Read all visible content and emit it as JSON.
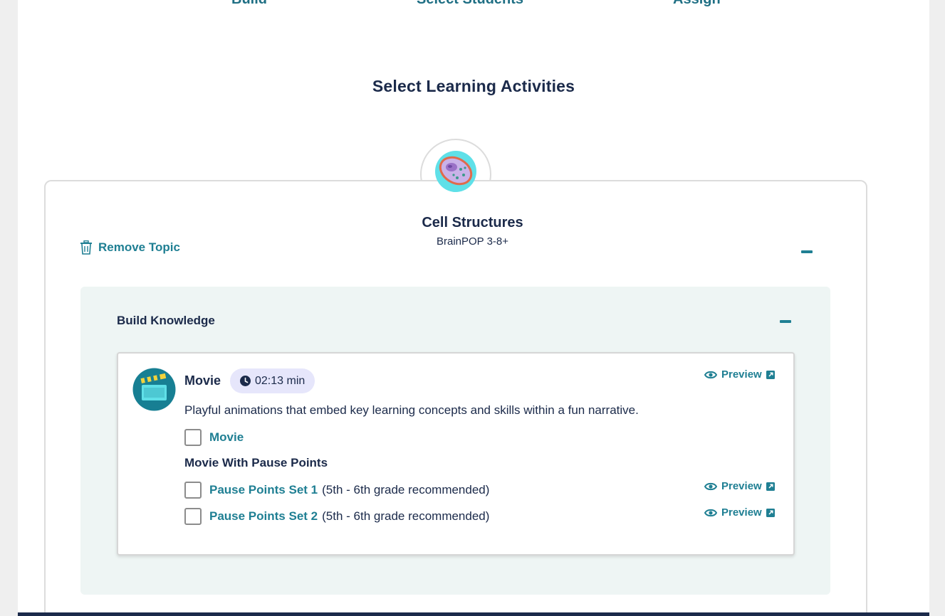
{
  "steps": [
    "Build",
    "Select Students",
    "Assign"
  ],
  "heading": "Select Learning Activities",
  "topic": {
    "title": "Cell Structures",
    "subtitle": "BrainPOP 3-8+",
    "remove_label": "Remove Topic",
    "image_icon": "cell-illustration-icon"
  },
  "section": {
    "title": "Build Knowledge"
  },
  "activity": {
    "title": "Movie",
    "duration": "02:13 min",
    "description": "Playful animations that embed key learning concepts and skills within a fun narrative.",
    "preview_label": "Preview",
    "options": [
      {
        "label": "Movie",
        "note": ""
      }
    ],
    "pause_heading": "Movie With Pause Points",
    "pause_options": [
      {
        "label": "Pause Points Set 1",
        "note": "(5th - 6th grade recommended)"
      },
      {
        "label": "Pause Points Set 2",
        "note": "(5th - 6th grade recommended)"
      }
    ]
  },
  "colors": {
    "accent": "#1f7f93",
    "text": "#1b2a4a",
    "section_bg": "#eef5f4",
    "duration_bg": "#e6e6fb"
  }
}
